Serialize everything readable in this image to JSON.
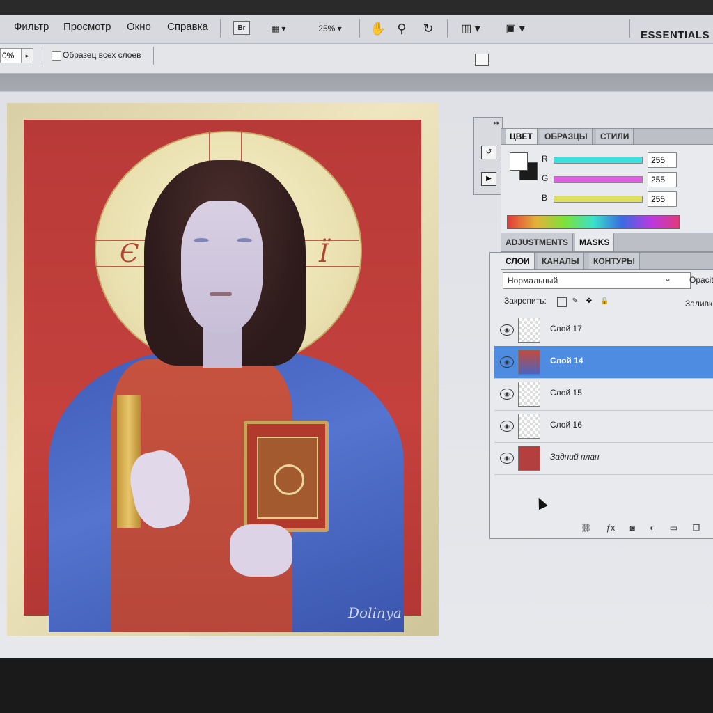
{
  "menu": {
    "items": [
      "Фильтр",
      "Просмотр",
      "Окно",
      "Справка"
    ]
  },
  "toolbar": {
    "bridge_label": "Br",
    "zoom": "25%",
    "workspace": "ESSENTIALS"
  },
  "options": {
    "percent": "0%",
    "sample_all_layers": "Образец всех слоев"
  },
  "color_panel": {
    "tabs": [
      "ЦВЕТ",
      "ОБРАЗЦЫ",
      "СТИЛИ"
    ],
    "channels": [
      {
        "label": "R",
        "value": "255",
        "color": "#3ee0e0"
      },
      {
        "label": "G",
        "value": "255",
        "color": "#e05fe0"
      },
      {
        "label": "B",
        "value": "255",
        "color": "#e0e05f"
      }
    ]
  },
  "adjustments": {
    "tabs": [
      "ADJUSTMENTS",
      "MASKS"
    ]
  },
  "layers_panel": {
    "tabs": [
      "СЛОИ",
      "КАНАЛЫ",
      "КОНТУРЫ"
    ],
    "blend_mode": "Нормальный",
    "opacity_label": "Opacit",
    "lock_label": "Закрепить:",
    "fill_label": "Заливк",
    "layers": [
      {
        "name": "Слой 17",
        "selected": false
      },
      {
        "name": "Слой 14",
        "selected": true
      },
      {
        "name": "Слой 15",
        "selected": false
      },
      {
        "name": "Слой 16",
        "selected": false
      },
      {
        "name": "Задний план",
        "selected": false
      }
    ],
    "footer_icons": [
      "link-icon",
      "fx-icon",
      "mask-icon",
      "adjustment-icon",
      "folder-icon",
      "new-layer-icon"
    ]
  },
  "artwork": {
    "halo_letters": [
      "Є",
      "Ї"
    ],
    "signature": "Dolinya"
  }
}
